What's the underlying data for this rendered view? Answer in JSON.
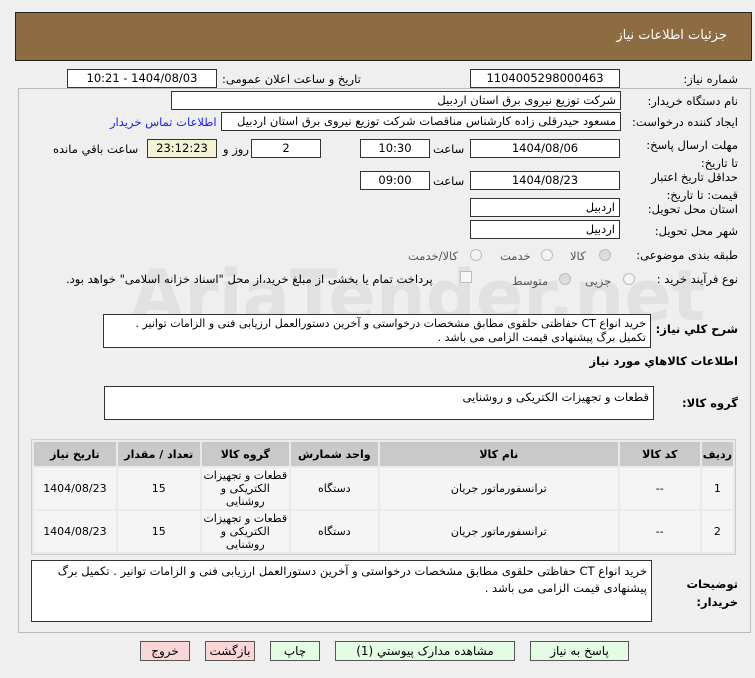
{
  "header": {
    "title": "جزئیات اطلاعات نیاز"
  },
  "form": {
    "need_number_label": "شماره نیاز:",
    "need_number": "1104005298000463",
    "announce_label": "تاریخ و ساعت اعلان عمومی:",
    "announce_value": "1404/08/03 - 10:21",
    "buyer_org_label": "نام دستگاه خریدار:",
    "buyer_org": "شرکت توزیع نیروی برق استان اردبیل",
    "creator_label": "ایجاد کننده درخواست:",
    "creator": "مسعود حیدرقلی زاده کارشناس مناقصات شرکت توزیع نیروی برق استان اردبیل",
    "contact_link": "اطلاعات تماس خریدار",
    "deadline_label": "مهلت ارسال پاسخ: تا تاریخ:",
    "deadline_date": "1404/08/06",
    "time_label": "ساعت",
    "deadline_time": "10:30",
    "days": "2",
    "days_label": "روز و",
    "remaining": "23:12:23",
    "remaining_label": "ساعت باقي مانده",
    "validity_label": "حداقل تاريخ اعتبار قیمت: تا تاریخ:",
    "validity_date": "1404/08/23",
    "validity_time": "09:00",
    "province_label": "استان محل تحویل:",
    "province": "اردبیل",
    "city_label": "شهر محل تحویل:",
    "city": "اردبیل",
    "category_label": "طبقه بندی موضوعی:",
    "category_options": [
      "کالا",
      "خدمت",
      "کالا/خدمت"
    ],
    "category_selected": "کالا",
    "process_label": "نوع فرآیند خرید :",
    "process_options": [
      "جزیی",
      "متوسط"
    ],
    "payment_note": "پرداخت تمام یا بخشی از مبلغ خرید،از محل \"اسناد خزانه اسلامی\" خواهد بود.",
    "description_label": "شرح کلي نياز:",
    "description": "خرید انواع CT حفاظتی حلقوی مطابق مشخصات درخواستی و آخرین دستورالعمل ارزیابی فنی و الزامات توانیر . تکمیل برگ پیشنهادی قیمت الزامی می باشد ."
  },
  "goods": {
    "section_title": "اطلاعات کالاهاي مورد نياز",
    "group_label": "گروه کالا:",
    "group_value": "قطعات و تجهیزات الکتریکی و روشنایی",
    "columns": [
      "ردیف",
      "کد کالا",
      "نام کالا",
      "واحد شمارش",
      "گروه کالا",
      "تعداد / مقدار",
      "تاریخ نیاز"
    ],
    "rows": [
      [
        "1",
        "--",
        "ترانسفورماتور جریان",
        "دستگاه",
        "قطعات و تجهیزات الکتریکی و روشنایی",
        "15",
        "1404/08/23"
      ],
      [
        "2",
        "--",
        "ترانسفورماتور جریان",
        "دستگاه",
        "قطعات و تجهیزات الکتریکی و روشنایی",
        "15",
        "1404/08/23"
      ]
    ],
    "notes_label": "توضیحات خریدار:",
    "notes": "خرید انواع CT حفاظتی حلقوی مطابق مشخصات درخواستی و آخرین دستورالعمل ارزیابی فنی و الزامات توانیر . تکمیل برگ پیشنهادی قیمت الزامی می باشد ."
  },
  "buttons": {
    "reply": "پاسخ به نیاز",
    "attachments": "مشاهده مدارک پیوستي (1)",
    "print": "چاپ",
    "back": "بازگشت",
    "exit": "خروج"
  },
  "watermark": "AriaTender.net",
  "colors": {
    "header": "#8d6c42",
    "link": "#1a1aff",
    "remaining_bg": "#f3f3d3",
    "green_btn": "#e4fbe4",
    "pink_btn": "#fbd6d6"
  }
}
